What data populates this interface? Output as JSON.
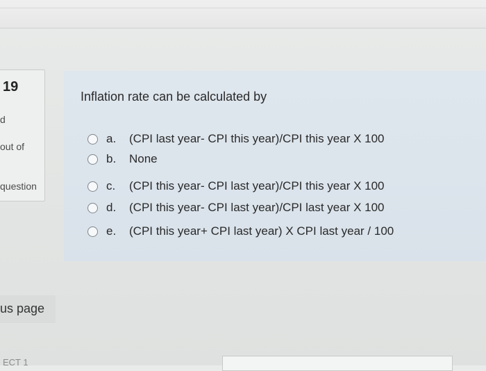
{
  "question": {
    "number": "19",
    "side": {
      "state": "d",
      "marks": "out of",
      "flag": "question"
    },
    "text": "Inflation rate can be calculated by",
    "options": [
      {
        "letter": "a.",
        "text": "(CPI last year- CPI this year)/CPI this year X 100"
      },
      {
        "letter": "b.",
        "text": "None"
      },
      {
        "letter": "c.",
        "text": "(CPI this year- CPI last year)/CPI this year X 100"
      },
      {
        "letter": "d.",
        "text": "(CPI this year- CPI last year)/CPI last year X 100"
      },
      {
        "letter": "e.",
        "text": "(CPI this year+ CPI last year) X CPI last year / 100"
      }
    ]
  },
  "nav": {
    "previous_label": "us page"
  },
  "footer": {
    "partial_text": "ECT 1"
  }
}
